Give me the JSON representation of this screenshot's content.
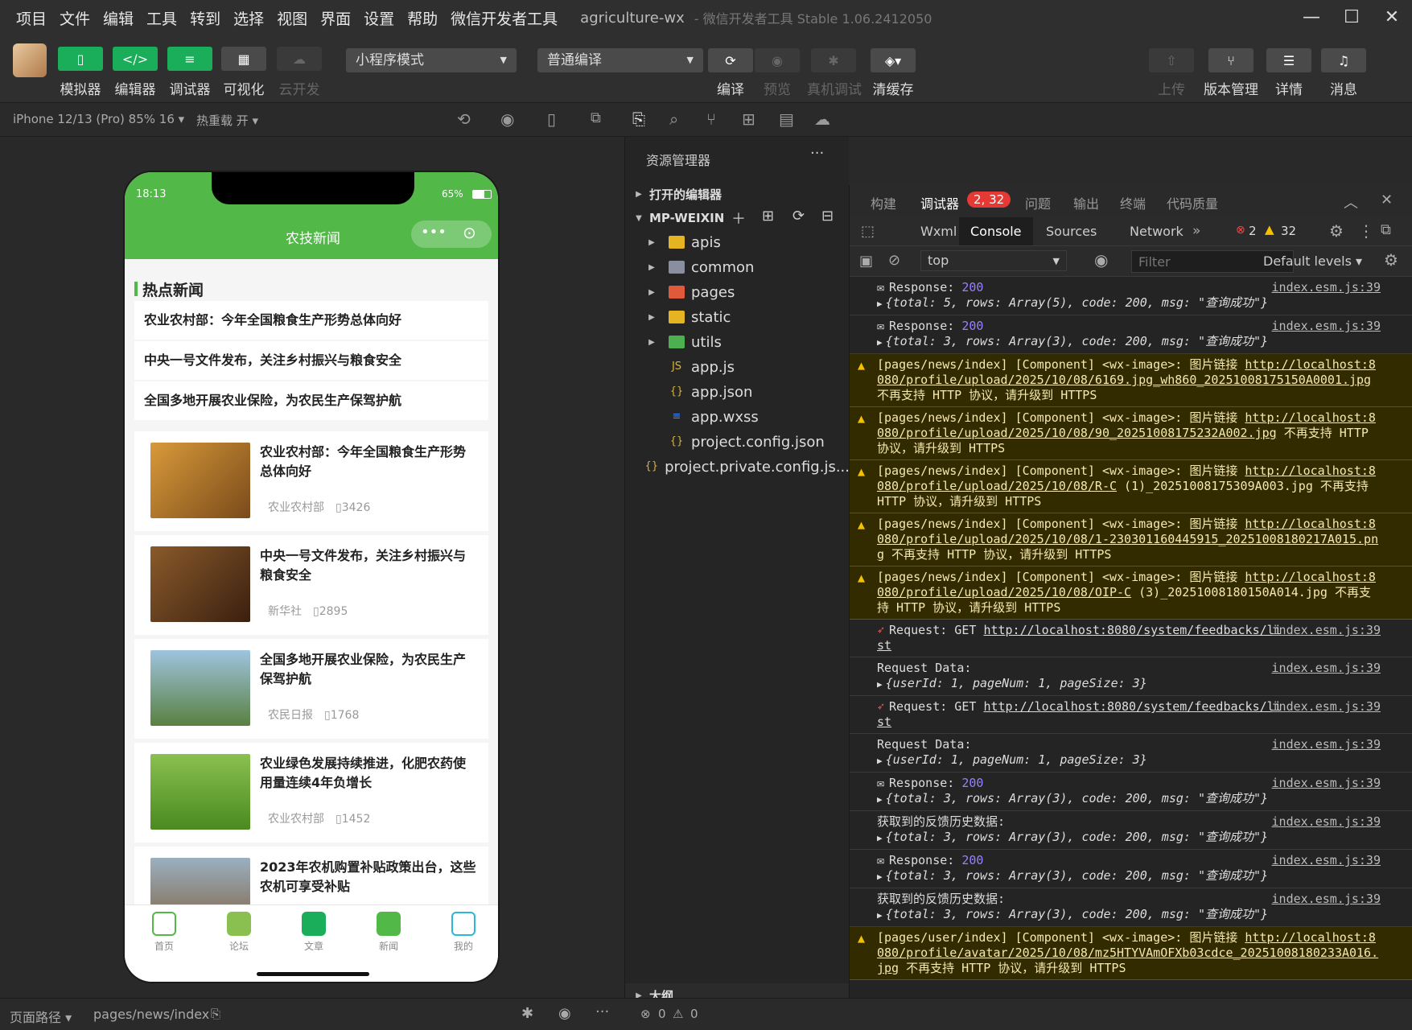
{
  "menu": {
    "items": [
      "项目",
      "文件",
      "编辑",
      "工具",
      "转到",
      "选择",
      "视图",
      "界面",
      "设置",
      "帮助",
      "微信开发者工具"
    ],
    "title": "agriculture-wx",
    "subtitle": "- 微信开发者工具 Stable 1.06.2412050"
  },
  "toolbar": {
    "simulator": "模拟器",
    "editor": "编辑器",
    "debugger": "调试器",
    "visual": "可视化",
    "cloud": "云开发",
    "mode": "小程序模式",
    "compile_mode": "普通编译",
    "compile": "编译",
    "preview": "预览",
    "real_debug": "真机调试",
    "clear_cache": "清缓存",
    "upload": "上传",
    "version": "版本管理",
    "detail": "详情",
    "message": "消息"
  },
  "bar2": {
    "device": "iPhone 12/13 (Pro) 85% 16 ▾",
    "hot_reload": "热重载 开 ▾"
  },
  "phone": {
    "time": "18:13",
    "battery": "65%",
    "nav_title": "农技新闻",
    "hot_title": "热点新闻",
    "hot": [
      "农业农村部：今年全国粮食生产形势总体向好",
      "中央一号文件发布，关注乡村振兴与粮食安全",
      "全国多地开展农业保险，为农民生产保驾护航"
    ],
    "cards": [
      {
        "title": "农业农村部：今年全国粮食生产形势总体向好",
        "source": "农业农村部",
        "views": "3426"
      },
      {
        "title": "中央一号文件发布，关注乡村振兴与粮食安全",
        "source": "新华社",
        "views": "2895"
      },
      {
        "title": "全国多地开展农业保险，为农民生产保驾护航",
        "source": "农民日报",
        "views": "1768"
      },
      {
        "title": "农业绿色发展持续推进，化肥农药使用量连续4年负增长",
        "source": "农业农村部",
        "views": "1452"
      },
      {
        "title": "2023年农机购置补贴政策出台，这些农机可享受补贴",
        "source": "",
        "views": ""
      }
    ],
    "tabs": [
      "首页",
      "论坛",
      "文章",
      "新闻",
      "我的"
    ]
  },
  "explorer": {
    "title": "资源管理器",
    "open_editors": "打开的编辑器",
    "project": "MP-WEIXIN",
    "outline": "大纲",
    "files": [
      {
        "name": "apis",
        "type": "folder"
      },
      {
        "name": "common",
        "type": "folder"
      },
      {
        "name": "pages",
        "type": "folder"
      },
      {
        "name": "static",
        "type": "folder"
      },
      {
        "name": "utils",
        "type": "folder"
      },
      {
        "name": "app.js",
        "type": "js"
      },
      {
        "name": "app.json",
        "type": "json"
      },
      {
        "name": "app.wxss",
        "type": "wxss"
      },
      {
        "name": "project.config.json",
        "type": "json"
      },
      {
        "name": "project.private.config.js...",
        "type": "json"
      }
    ]
  },
  "devtools": {
    "top_tabs": [
      "构建",
      "调试器",
      "问题",
      "输出",
      "终端",
      "代码质量"
    ],
    "badge": "2, 32",
    "tabs": [
      "Wxml",
      "Console",
      "Sources",
      "Network"
    ],
    "errors": "2",
    "warnings": "32",
    "context": "top",
    "filter_placeholder": "Filter",
    "levels": "Default levels ▾"
  },
  "log": {
    "src": "index.esm.js:39",
    "entries": [
      {
        "kind": "resp",
        "label": "Response: ",
        "code": "200",
        "obj": "{total: 5, rows: Array(5), code: 200, msg: \"查询成功\"}"
      },
      {
        "kind": "resp",
        "label": "Response: ",
        "code": "200",
        "obj": "{total: 3, rows: Array(3), code: 200, msg: \"查询成功\"}"
      },
      {
        "kind": "warn",
        "pre": "[pages/news/index] [Component] <wx-image>: 图片链接 ",
        "link": "http://localhost:8080/profile/upload/2025/10/08/6169.jpg_wh860_20251008175150A0001.jpg",
        "post": " 不再支持 HTTP 协议，请升级到 HTTPS"
      },
      {
        "kind": "warn",
        "pre": "[pages/news/index] [Component] <wx-image>: 图片链接 ",
        "link": "http://localhost:8080/profile/upload/2025/10/08/90_20251008175232A002.jpg",
        "post": " 不再支持 HTTP 协议，请升级到 HTTPS"
      },
      {
        "kind": "warn",
        "pre": "[pages/news/index] [Component] <wx-image>: 图片链接 ",
        "link": "http://localhost:8080/profile/upload/2025/10/08/R-C",
        "post": " (1)_20251008175309A003.jpg 不再支持 HTTP 协议，请升级到 HTTPS"
      },
      {
        "kind": "warn",
        "pre": "[pages/news/index] [Component] <wx-image>: 图片链接 ",
        "link": "http://localhost:8080/profile/upload/2025/10/08/1-230301160445915_20251008180217A015.png",
        "post": " 不再支持 HTTP 协议，请升级到 HTTPS"
      },
      {
        "kind": "warn",
        "pre": "[pages/news/index] [Component] <wx-image>: 图片链接 ",
        "link": "http://localhost:8080/profile/upload/2025/10/08/OIP-C",
        "post": " (3)_20251008180150A014.jpg 不再支持 HTTP 协议，请升级到 HTTPS"
      },
      {
        "kind": "req",
        "label": "Request: GET ",
        "url": "http://localhost:8080/system/feedbacks/list"
      },
      {
        "kind": "data",
        "label": "Request Data:",
        "obj": "{userId: 1, pageNum: 1, pageSize: 3}"
      },
      {
        "kind": "req",
        "label": "Request: GET ",
        "url": "http://localhost:8080/system/feedbacks/list"
      },
      {
        "kind": "data",
        "label": "Request Data:",
        "obj": "{userId: 1, pageNum: 1, pageSize: 3}"
      },
      {
        "kind": "resp",
        "label": "Response: ",
        "code": "200",
        "obj": "{total: 3, rows: Array(3), code: 200, msg: \"查询成功\"}"
      },
      {
        "kind": "data",
        "label": "获取到的反馈历史数据:",
        "obj": "{total: 3, rows: Array(3), code: 200, msg: \"查询成功\"}"
      },
      {
        "kind": "resp",
        "label": "Response: ",
        "code": "200",
        "obj": "{total: 3, rows: Array(3), code: 200, msg: \"查询成功\"}"
      },
      {
        "kind": "data",
        "label": "获取到的反馈历史数据:",
        "obj": "{total: 3, rows: Array(3), code: 200, msg: \"查询成功\"}"
      },
      {
        "kind": "warn",
        "pre": "[pages/user/index] [Component] <wx-image>: 图片链接 ",
        "link": "http://localhost:8080/profile/avatar/2025/10/08/mz5HTYVAmOFXb03cdce_20251008180233A016.jpg",
        "post": " 不再支持 HTTP 协议，请升级到 HTTPS"
      }
    ]
  },
  "status": {
    "path_label": "页面路径 ▾",
    "path": "pages/news/index",
    "errors": "0",
    "warnings": "0"
  }
}
